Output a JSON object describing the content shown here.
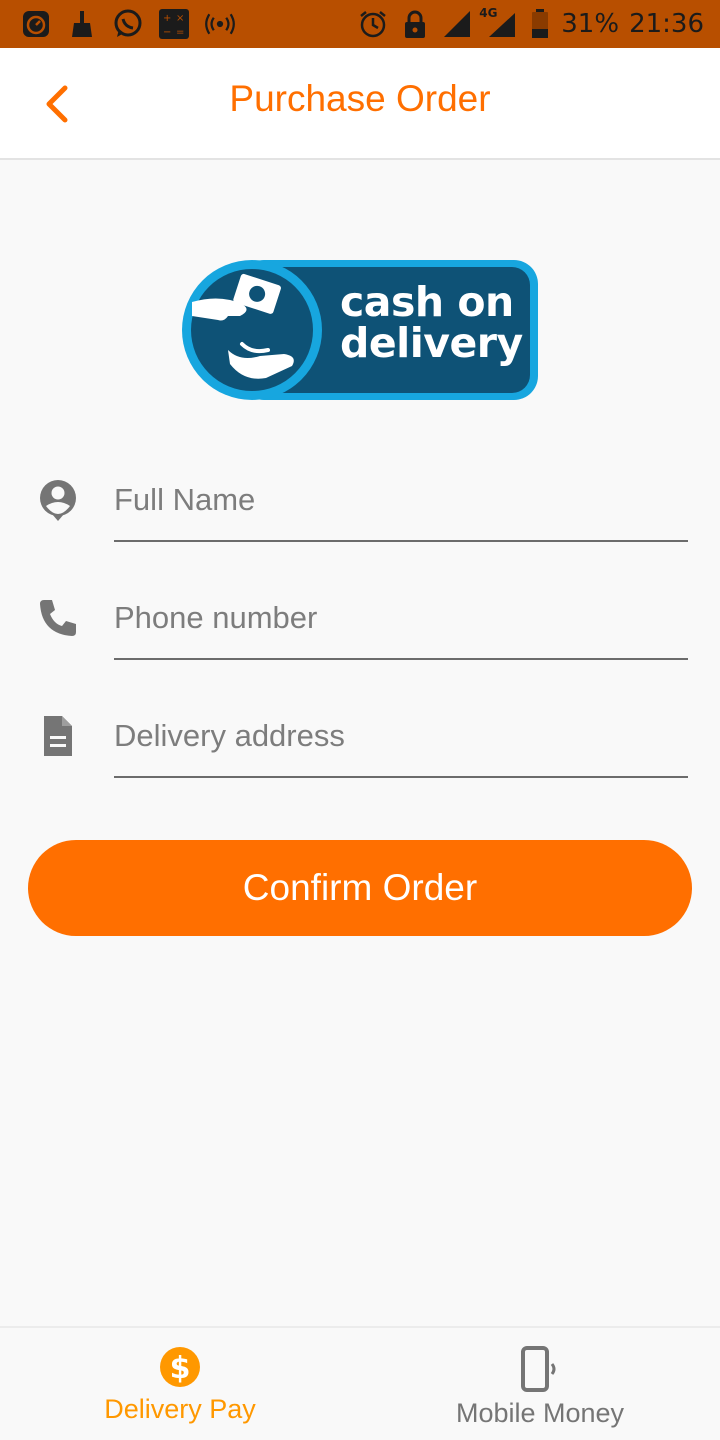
{
  "colors": {
    "accent": "#ff6f00",
    "status_bar": "#b84f00",
    "logo_dark": "#0e5276",
    "logo_light": "#17a6df",
    "inactive": "#757575"
  },
  "status_bar": {
    "icons": [
      "speedometer-icon",
      "broom-icon",
      "whatsapp-icon",
      "calculator-icon",
      "hotspot-icon",
      "alarm-icon",
      "lock-icon",
      "signal-icon",
      "signal-4g-icon",
      "battery-icon"
    ],
    "network_label": "4G",
    "battery": "31%",
    "time": "21:36"
  },
  "header": {
    "title": "Purchase Order",
    "back_icon": "chevron-left-icon"
  },
  "logo": {
    "line1": "cash on",
    "line2": "delivery"
  },
  "form": {
    "full_name": {
      "icon": "account-icon",
      "placeholder": "Full Name",
      "value": ""
    },
    "phone": {
      "icon": "phone-icon",
      "placeholder": "Phone number",
      "value": ""
    },
    "address": {
      "icon": "document-icon",
      "placeholder": "Delivery address",
      "value": ""
    },
    "confirm_label": "Confirm Order"
  },
  "bottom_nav": {
    "items": [
      {
        "label": "Delivery Pay",
        "icon": "dollar-circle-icon",
        "active": true
      },
      {
        "label": "Mobile Money",
        "icon": "phone-vibrate-icon",
        "active": false
      }
    ]
  }
}
